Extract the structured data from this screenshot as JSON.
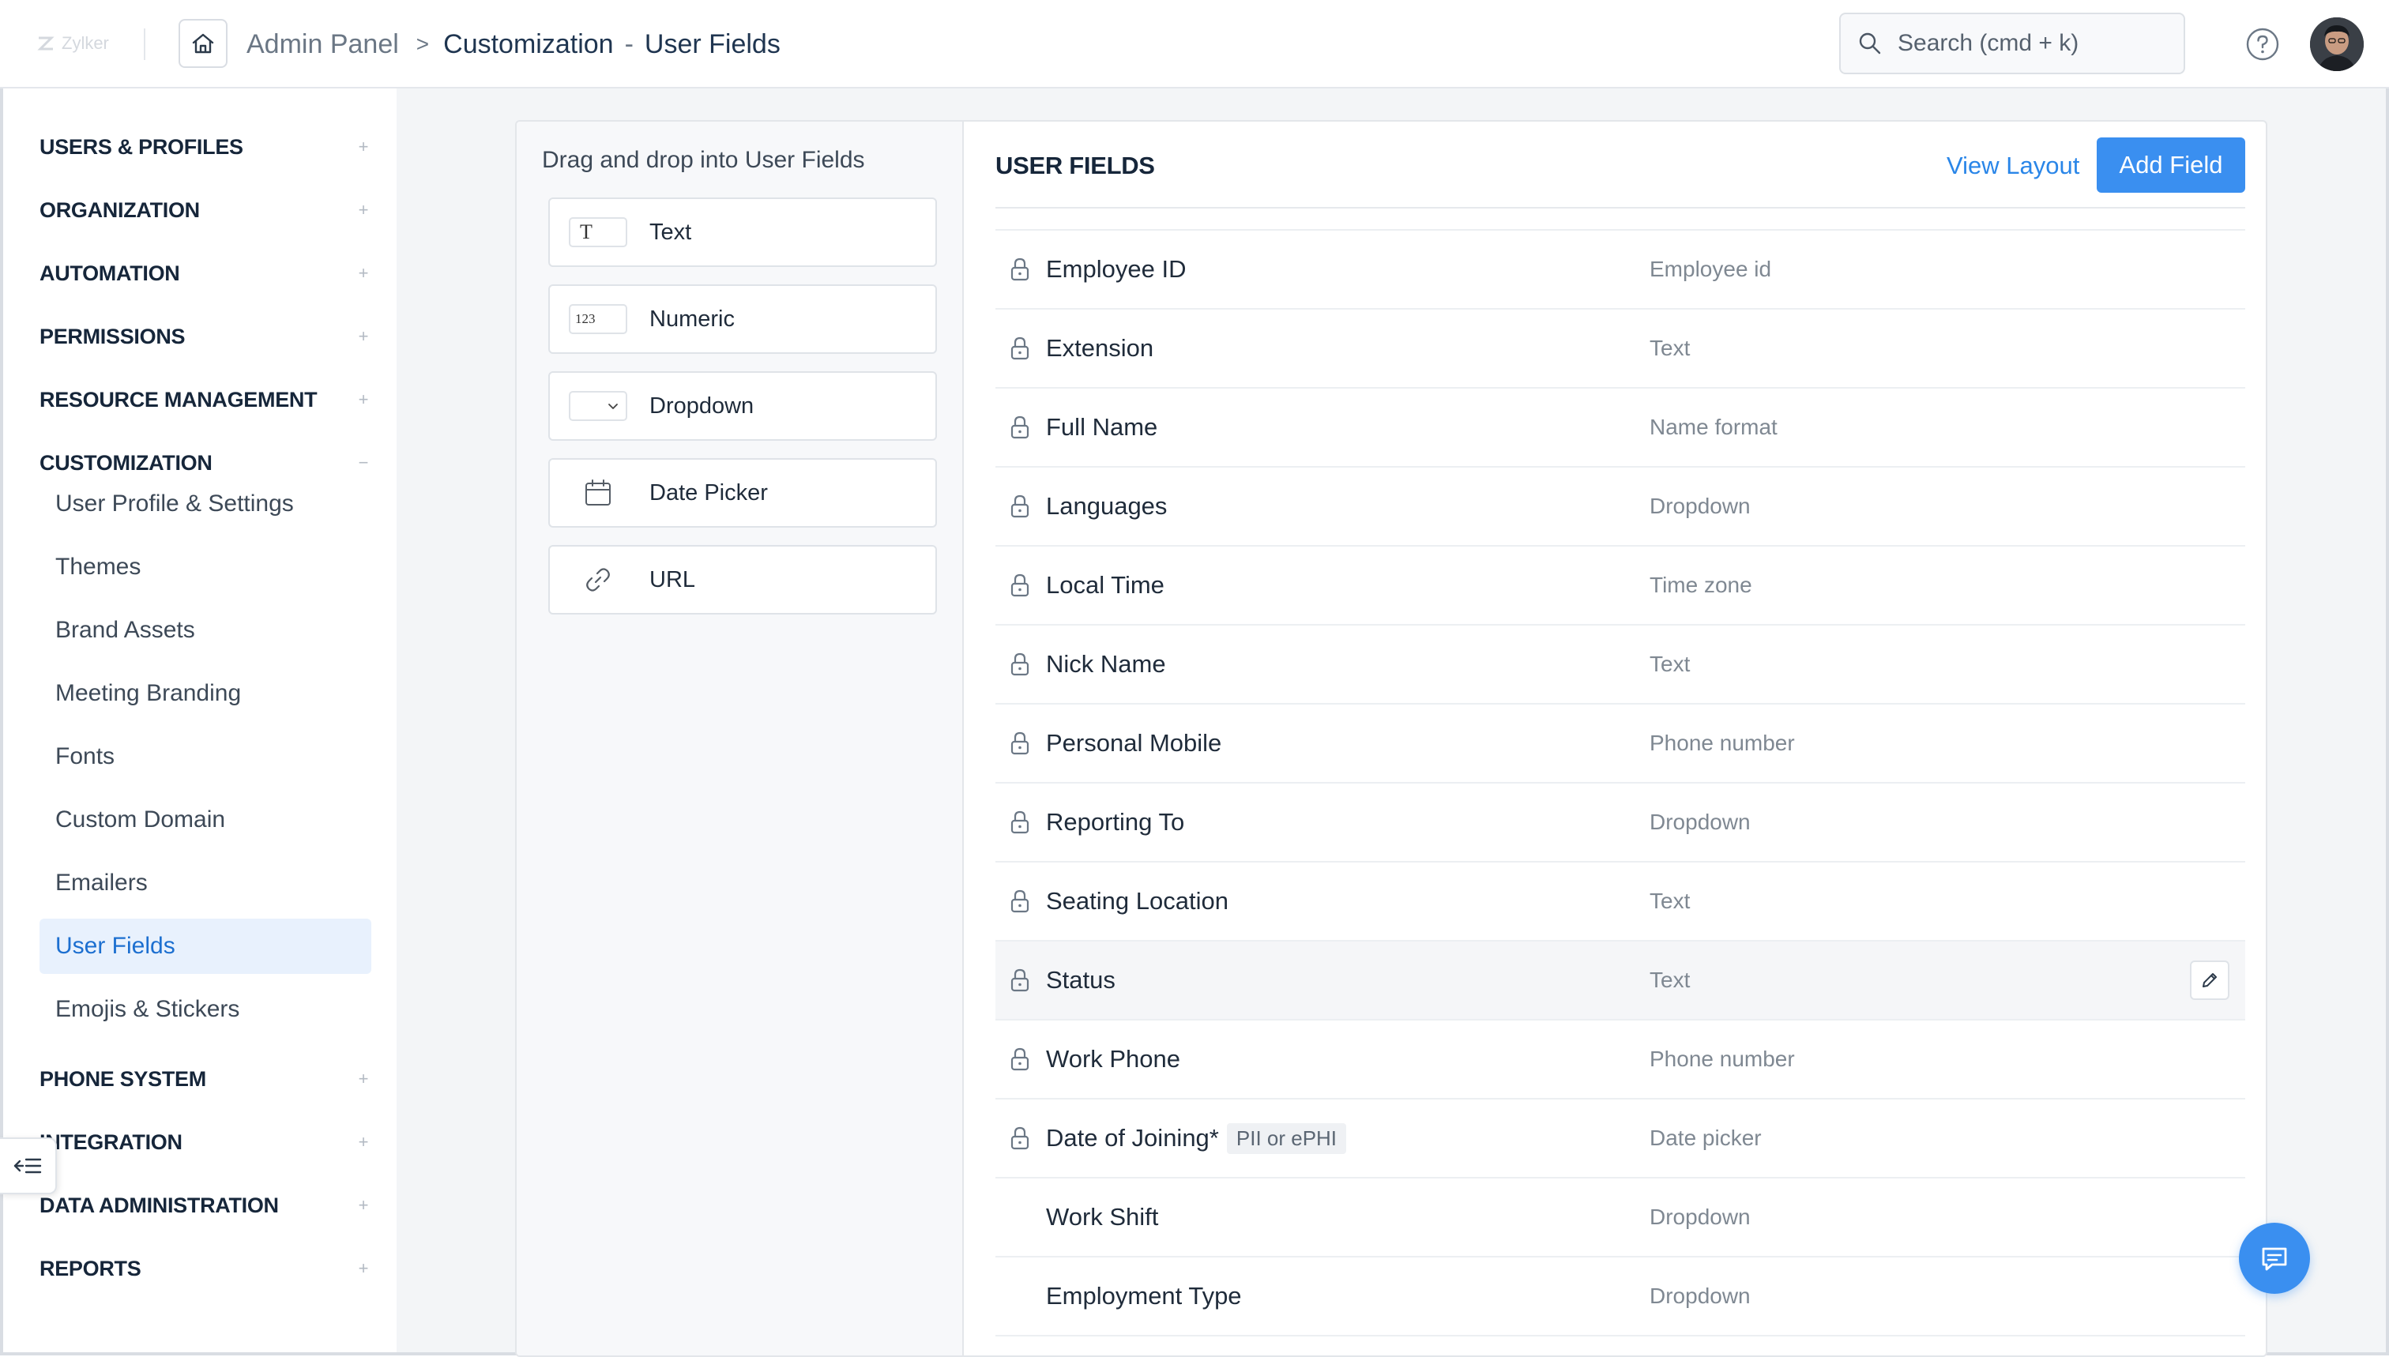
{
  "brand": {
    "name": "Zylker"
  },
  "breadcrumb": {
    "root": "Admin Panel",
    "separator": ">",
    "section": "Customization",
    "dash": "-",
    "current": "User Fields"
  },
  "search": {
    "placeholder": "Search (cmd + k)"
  },
  "sidebar": {
    "sections": [
      {
        "label": "USERS & PROFILES",
        "toggle": "+"
      },
      {
        "label": "ORGANIZATION",
        "toggle": "+"
      },
      {
        "label": "AUTOMATION",
        "toggle": "+"
      },
      {
        "label": "PERMISSIONS",
        "toggle": "+"
      },
      {
        "label": "RESOURCE MANAGEMENT",
        "toggle": "+"
      },
      {
        "label": "CUSTOMIZATION",
        "toggle": "−"
      },
      {
        "label": "PHONE SYSTEM",
        "toggle": "+"
      },
      {
        "label": "INTEGRATION",
        "toggle": "+"
      },
      {
        "label": "DATA ADMINISTRATION",
        "toggle": "+"
      },
      {
        "label": "REPORTS",
        "toggle": "+"
      }
    ],
    "customization_items": [
      "User Profile & Settings",
      "Themes",
      "Brand Assets",
      "Meeting Branding",
      "Fonts",
      "Custom Domain",
      "Emailers",
      "User Fields",
      "Emojis & Stickers"
    ],
    "active_item": "User Fields"
  },
  "palette": {
    "title": "Drag and drop into User Fields",
    "items": [
      {
        "label": "Text",
        "icon": "text-type-icon",
        "glyph": "T"
      },
      {
        "label": "Numeric",
        "icon": "numeric-type-icon",
        "glyph": "123"
      },
      {
        "label": "Dropdown",
        "icon": "dropdown-type-icon",
        "glyph": ""
      },
      {
        "label": "Date Picker",
        "icon": "calendar-icon",
        "glyph": ""
      },
      {
        "label": "URL",
        "icon": "link-icon",
        "glyph": ""
      }
    ]
  },
  "fields": {
    "title": "USER FIELDS",
    "view_layout": "View Layout",
    "add_field": "Add Field",
    "rows": [
      {
        "name": "Employee ID",
        "type": "Employee id",
        "locked": true
      },
      {
        "name": "Extension",
        "type": "Text",
        "locked": true
      },
      {
        "name": "Full Name",
        "type": "Name format",
        "locked": true
      },
      {
        "name": "Languages",
        "type": "Dropdown",
        "locked": true
      },
      {
        "name": "Local Time",
        "type": "Time zone",
        "locked": true
      },
      {
        "name": "Nick Name",
        "type": "Text",
        "locked": true
      },
      {
        "name": "Personal Mobile",
        "type": "Phone number",
        "locked": true
      },
      {
        "name": "Reporting To",
        "type": "Dropdown",
        "locked": true
      },
      {
        "name": "Seating Location",
        "type": "Text",
        "locked": true
      },
      {
        "name": "Status",
        "type": "Text",
        "locked": true,
        "hovered": true
      },
      {
        "name": "Work Phone",
        "type": "Phone number",
        "locked": true
      },
      {
        "name": "Date of Joining*",
        "type": "Date picker",
        "locked": true,
        "tag": "PII or ePHI"
      },
      {
        "name": "Work Shift",
        "type": "Dropdown",
        "locked": false
      },
      {
        "name": "Employment Type",
        "type": "Dropdown",
        "locked": false
      }
    ]
  },
  "colors": {
    "accent": "#3a8ff0",
    "link": "#2a86e8",
    "active_bg": "#e8f1fd",
    "active_text": "#1c6fd0"
  }
}
